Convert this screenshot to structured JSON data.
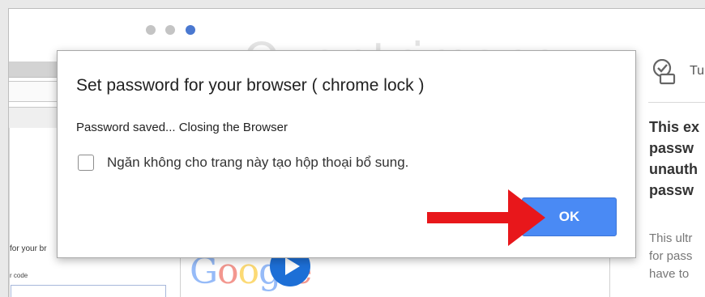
{
  "watermark": "Quantrimang",
  "background_page": {
    "left_text": "for your br",
    "left_small_text": "r code",
    "google_logo": "Google"
  },
  "right_panel": {
    "label": "Tu",
    "bold_lines": [
      "This ex",
      "passw",
      "unauth",
      "passw"
    ],
    "body_lines": [
      "This ultr",
      "for pass",
      "have to"
    ]
  },
  "dialog": {
    "title": "Set password for your browser ( chrome lock )",
    "message": "Password saved... Closing the Browser",
    "checkbox_label": "Ngăn không cho trang này tạo hộp thoại bổ sung.",
    "checkbox_checked": false,
    "ok_label": "OK"
  },
  "colors": {
    "ok_button": "#4a8af4",
    "arrow": "#e8171b",
    "active_dot": "#4a78d0"
  }
}
